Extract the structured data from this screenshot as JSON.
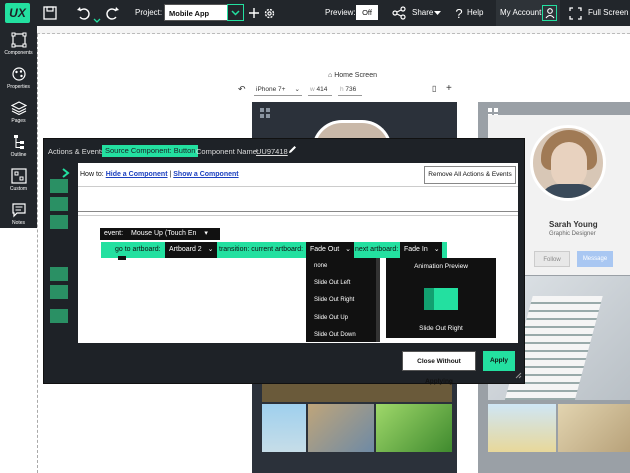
{
  "app": {
    "logo": "UX"
  },
  "toolbar": {
    "project_label": "Project:",
    "project_value": "Mobile App",
    "preview_label": "Preview:",
    "preview_value": "Off",
    "share_label": "Share",
    "help_label": "Help",
    "account_label": "My Account",
    "fullscreen_label": "Full Screen"
  },
  "sidebar": {
    "items": [
      {
        "label": "Components",
        "icon": "components-icon"
      },
      {
        "label": "Properties",
        "icon": "properties-icon"
      },
      {
        "label": "Pages",
        "icon": "pages-icon"
      },
      {
        "label": "Outline",
        "icon": "outline-icon"
      },
      {
        "label": "Custom",
        "icon": "custom-icon"
      },
      {
        "label": "Notes",
        "icon": "notes-icon"
      }
    ]
  },
  "canvas": {
    "home_label": "Home Screen",
    "device": "iPhone 7+",
    "width": "414",
    "height": "736",
    "profile_name": "Sarah Young",
    "profile_role": "Graphic Designer",
    "follow_label": "Follow",
    "message_label": "Message"
  },
  "modal": {
    "title": "Actions & Events",
    "source_component": "Source Component: Button",
    "component_name_label": "Component Name:",
    "component_name_value": "UU97418",
    "howto_prefix": "How to:",
    "howto_hide": "Hide a Component",
    "howto_sep": "|",
    "howto_show": "Show a Component",
    "remove_all": "Remove All Actions & Events",
    "event_label": "event:",
    "event_value": "Mouse Up (Touch En",
    "goto_label": "go to artboard:",
    "goto_value": "Artboard 2",
    "transition_label": "transition: current artboard:",
    "current_transition": "Fade Out",
    "next_label": "next artboard:",
    "next_transition": "Fade In",
    "dropdown_options": [
      "none",
      "Slide Out Left",
      "Slide Out Right",
      "Slide Out Up",
      "Slide Out Down"
    ],
    "preview_title": "Animation Preview",
    "preview_caption": "Slide Out Right",
    "close_label": "Close Without Applying",
    "apply_label": "Apply"
  },
  "colors": {
    "accent": "#23e0a0",
    "dark": "#22262b",
    "modal": "#1e2227"
  }
}
